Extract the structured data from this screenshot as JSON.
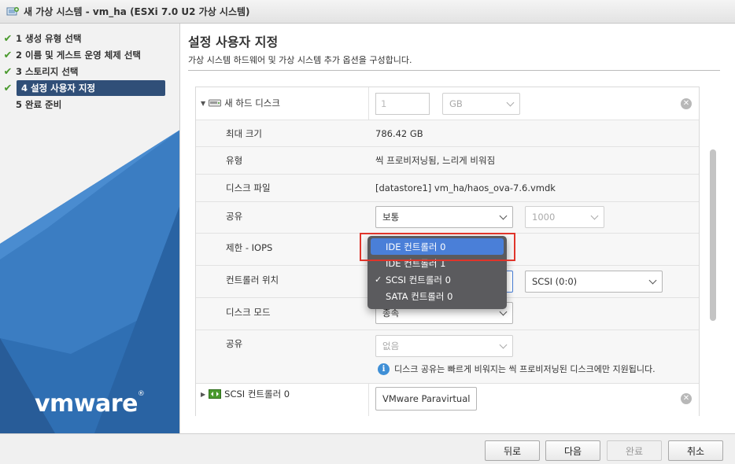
{
  "window": {
    "title": "새 가상 시스템 - vm_ha (ESXi 7.0 U2 가상 시스템)"
  },
  "steps": [
    {
      "label": "1 생성 유형 선택",
      "done": true
    },
    {
      "label": "2 이름 및 게스트 운영 체제 선택",
      "done": true
    },
    {
      "label": "3 스토리지 선택",
      "done": true
    },
    {
      "label": "4 설정 사용자 지정",
      "done": true,
      "active": true
    },
    {
      "label": "5 완료 준비",
      "done": false
    }
  ],
  "brand": {
    "logo_text": "vmware",
    "logo_mark": "®"
  },
  "main": {
    "title": "설정 사용자 지정",
    "description": "가상 시스템 하드웨어 및 가상 시스템 추가 옵션을 구성합니다."
  },
  "disk": {
    "section_label": "새 하드 디스크",
    "size_value": "1",
    "size_unit": "GB",
    "max_size_label": "최대 크기",
    "max_size_value": "786.42 GB",
    "type_label": "유형",
    "type_value": "씩 프로비저닝됨, 느리게 비워짐",
    "file_label": "디스크 파일",
    "file_value": "[datastore1] vm_ha/haos_ova-7.6.vmdk",
    "shares_label": "공유",
    "shares_value": "보통",
    "shares_number": "1000",
    "iops_label": "제한 - IOPS",
    "controller_label": "컨트롤러 위치",
    "controller_port": "SCSI (0:0)",
    "mode_label": "디스크 모드",
    "mode_value": "종속",
    "sharing_label": "공유",
    "sharing_value": "없음",
    "sharing_info": "디스크 공유는 빠르게 비워지는 씩 프로비저닝된 디스크에만 지원됩니다."
  },
  "scsi": {
    "label": "SCSI 컨트롤러 0",
    "value": "VMware Paravirtual"
  },
  "controller_menu": {
    "options": [
      "IDE 컨트롤러 0",
      "IDE 컨트롤러 1",
      "SCSI 컨트롤러 0",
      "SATA 컨트롤러 0"
    ],
    "highlighted": "IDE 컨트롤러 0",
    "checked": "SCSI 컨트롤러 0"
  },
  "footer": {
    "back": "뒤로",
    "next": "다음",
    "finish": "완료",
    "cancel": "취소"
  },
  "colors": {
    "accent": "#304f78",
    "highlight": "#4a7fd8",
    "callout": "#e0352b",
    "check": "#4a9a2e"
  }
}
